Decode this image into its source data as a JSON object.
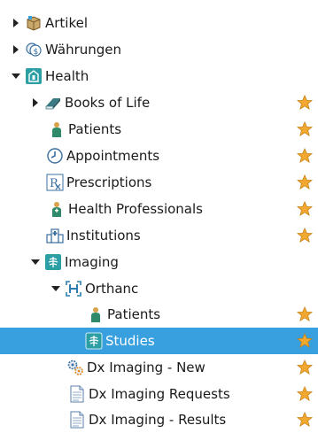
{
  "tree": {
    "items": [
      {
        "label": "Artikel",
        "icon": "package-icon",
        "expander": "collapsed",
        "favorite": false
      },
      {
        "label": "Währungen",
        "icon": "currency-icon",
        "expander": "collapsed",
        "favorite": false
      },
      {
        "label": "Health",
        "icon": "health-icon",
        "expander": "expanded",
        "favorite": false
      },
      {
        "label": "Books of Life",
        "icon": "book-icon",
        "expander": "collapsed",
        "favorite": true
      },
      {
        "label": "Patients",
        "icon": "patient-icon",
        "expander": "none",
        "favorite": true
      },
      {
        "label": "Appointments",
        "icon": "clock-icon",
        "expander": "none",
        "favorite": true
      },
      {
        "label": "Prescriptions",
        "icon": "prescription-icon",
        "expander": "none",
        "favorite": true
      },
      {
        "label": "Health Professionals",
        "icon": "doctor-icon",
        "expander": "none",
        "favorite": true
      },
      {
        "label": "Institutions",
        "icon": "hospital-icon",
        "expander": "none",
        "favorite": true
      },
      {
        "label": "Imaging",
        "icon": "xray-icon",
        "expander": "expanded",
        "favorite": false
      },
      {
        "label": "Orthanc",
        "icon": "orthanc-icon",
        "expander": "expanded",
        "favorite": false
      },
      {
        "label": "Patients",
        "icon": "patient-icon",
        "expander": "none",
        "favorite": true
      },
      {
        "label": "Studies",
        "icon": "xray-icon",
        "expander": "none",
        "favorite": true,
        "selected": true
      },
      {
        "label": "Dx Imaging - New",
        "icon": "gears-icon",
        "expander": "none",
        "favorite": true
      },
      {
        "label": "Dx Imaging Requests",
        "icon": "document-icon",
        "expander": "none",
        "favorite": true
      },
      {
        "label": "Dx Imaging - Results",
        "icon": "document-icon",
        "expander": "none",
        "favorite": true
      }
    ]
  },
  "colors": {
    "selection": "#39a0e0",
    "star": "#f0a830",
    "text": "#1a1a1a"
  }
}
